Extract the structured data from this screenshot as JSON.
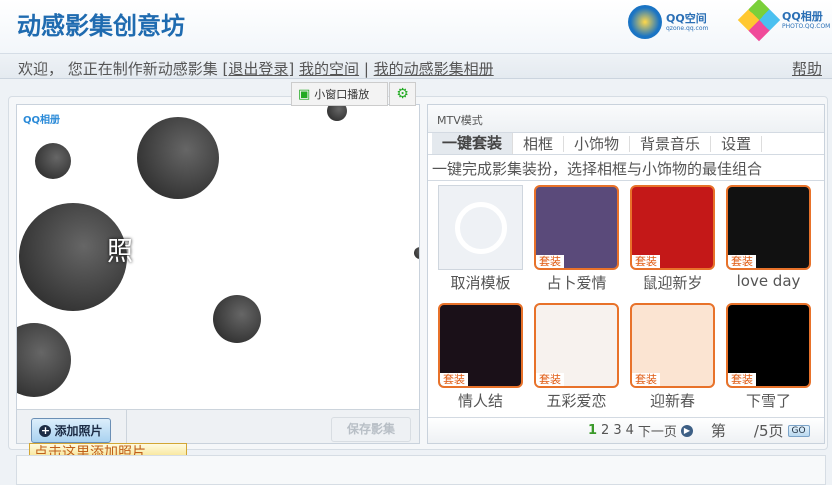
{
  "header": {
    "title": "动感影集创意坊",
    "qzone_logo": "QQ空间",
    "qzone_url": "qzone.qq.com",
    "photo_logo": "QQ相册",
    "photo_url": "PHOTO.QQ.COM"
  },
  "nav": {
    "welcome": "欢迎，  您正在制作新动感影集 ",
    "logout": "退出登录",
    "my_space": "我的空间",
    "my_albums": "我的动感影集相册",
    "help": "帮助"
  },
  "mini_player": {
    "label": "小窗口播放"
  },
  "preview": {
    "brand": "QQ相册",
    "partial_text": "照",
    "add_photo": "添加照片",
    "save": "保存影集",
    "tooltip": "点击这里添加照片"
  },
  "panel": {
    "title": "MTV模式",
    "tabs": [
      "一键套装",
      "相框",
      "小饰物",
      "背景音乐",
      "设置"
    ],
    "active_tab": "一键套装",
    "description": "一键完成影集装扮，选择相框与小饰物的最佳组合",
    "badge": "套装",
    "templates": [
      {
        "label": "取消模板",
        "bg": "#eef1f5"
      },
      {
        "label": "占卜爱情",
        "bg": "#5a4a7a"
      },
      {
        "label": "鼠迎新岁",
        "bg": "#c41818"
      },
      {
        "label": "love day",
        "bg": "#111111"
      },
      {
        "label": "情人结",
        "bg": "#1a1018"
      },
      {
        "label": "五彩爱恋",
        "bg": "#f7f2ee"
      },
      {
        "label": "迎新春",
        "bg": "#fbe4d2"
      },
      {
        "label": "下雪了",
        "bg": "#000000"
      }
    ],
    "pager": {
      "pages": [
        "1",
        "2",
        "3",
        "4"
      ],
      "current": "1",
      "next": "下一页",
      "page_prefix": "第",
      "page_suffix": "/5页",
      "go": "GO"
    }
  }
}
